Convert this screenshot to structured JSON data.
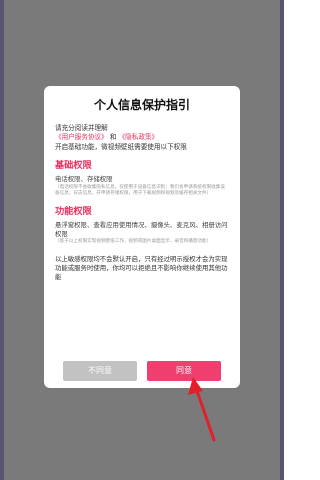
{
  "dialog": {
    "title": "个人信息保护指引",
    "intro_line1": "请充分阅读并理解",
    "user_agreement_link": "《用户服务协议》",
    "and_word": "和",
    "privacy_link": "《隐私政策》",
    "intro_line3": "开启基础功能，微视频壁纸需要使用以下权限",
    "basic_section": {
      "title": "基础权限",
      "subtitle": "电话权限、存储权限",
      "note": "（电话权限不会收集隐私信息，仅使用于设备信息识别；我们会申请系统权限收集设备信息、日志信息，开申请存储权限，用于下载视频和视频及缓存相关文件）"
    },
    "function_section": {
      "title": "功能权限",
      "subtitle": "悬浮窗权限、查看应用使用情况、摄像头、麦克风、相册访问权限",
      "note": "（基于以上权限实现视频壁纸工作，视频或图片桌面显示、录音和播放功能）"
    },
    "closing": "以上敏感权限均不会默认开启，只有经过明示授权才会为实现功能或服务时使用，你均可以拒绝且不影响你继续使用其他功能",
    "decline_label": "不同意",
    "agree_label": "同意"
  },
  "colors": {
    "accent": "#e8305f",
    "agree_button": "#ee3f6f",
    "decline_button": "#c2c2c2",
    "overlay": "#7a7a7a",
    "annotation_arrow": "#e0202a"
  }
}
